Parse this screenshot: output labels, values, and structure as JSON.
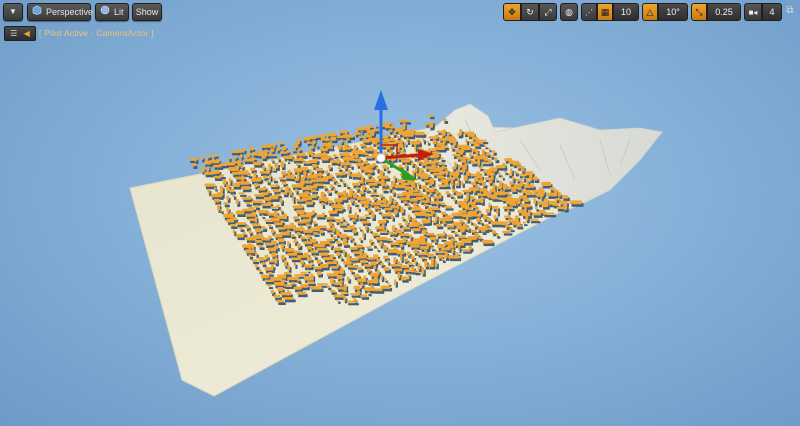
{
  "toolbar": {
    "menu_icon": "chevron-down-icon",
    "perspective_label": "Perspective",
    "lit_label": "Lit",
    "show_label": "Show",
    "grid_snap_value": "10",
    "rotation_snap_value": "10°",
    "scale_snap_value": "0.25",
    "camera_speed_value": "4"
  },
  "pilot_bar": {
    "status_text": "[ Pilot Active - CameraActor ]"
  },
  "colors": {
    "sky_background": "#86b1d8",
    "ground_plane": "#ece9d4",
    "buildings": "#f0a434",
    "building_shadow": "#3d5f77",
    "gizmo_z": "#2a6fe0",
    "gizmo_x": "#c01f12",
    "gizmo_y": "#2c9d1e",
    "toolbar_accent": "#f0a330"
  }
}
